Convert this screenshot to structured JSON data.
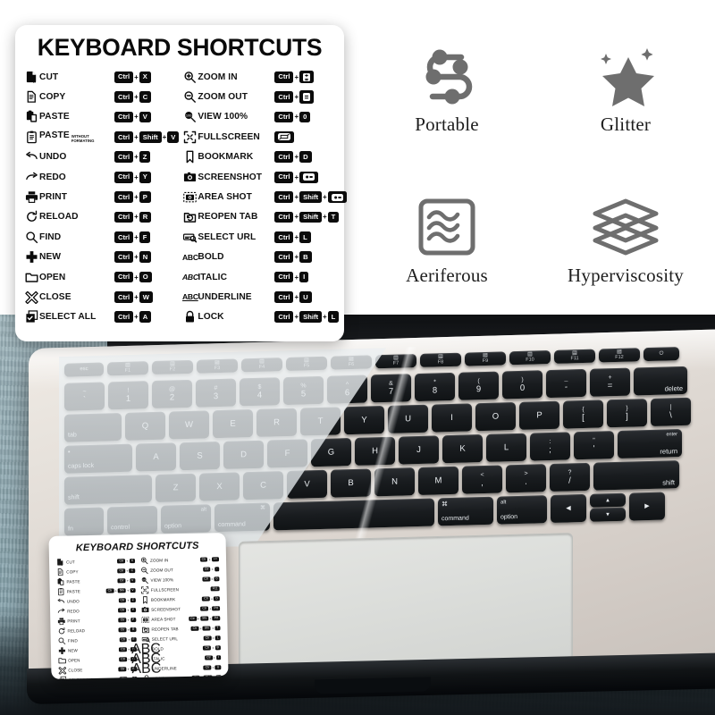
{
  "card": {
    "title": "KEYBOARD SHORTCUTS",
    "left_column": [
      {
        "icon": "cut-icon",
        "label": "CUT",
        "keys": [
          "Ctrl",
          "X"
        ]
      },
      {
        "icon": "copy-icon",
        "label": "COPY",
        "keys": [
          "Ctrl",
          "C"
        ]
      },
      {
        "icon": "paste-icon",
        "label": "PASTE",
        "keys": [
          "Ctrl",
          "V"
        ]
      },
      {
        "icon": "paste-plain-icon",
        "label": "PASTE",
        "sub": "WITHOUT FORMATING",
        "keys": [
          "Ctrl",
          "Shift",
          "V"
        ]
      },
      {
        "icon": "undo-icon",
        "label": "UNDO",
        "keys": [
          "Ctrl",
          "Z"
        ]
      },
      {
        "icon": "redo-icon",
        "label": "REDO",
        "keys": [
          "Ctrl",
          "Y"
        ]
      },
      {
        "icon": "print-icon",
        "label": "PRINT",
        "keys": [
          "Ctrl",
          "P"
        ]
      },
      {
        "icon": "reload-icon",
        "label": "RELOAD",
        "keys": [
          "Ctrl",
          "R"
        ]
      },
      {
        "icon": "find-icon",
        "label": "FIND",
        "keys": [
          "Ctrl",
          "F"
        ]
      },
      {
        "icon": "new-icon",
        "label": "NEW",
        "keys": [
          "Ctrl",
          "N"
        ]
      },
      {
        "icon": "open-folder-icon",
        "label": "OPEN",
        "keys": [
          "Ctrl",
          "O"
        ]
      },
      {
        "icon": "close-icon",
        "label": "CLOSE",
        "keys": [
          "Ctrl",
          "W"
        ]
      },
      {
        "icon": "select-all-icon",
        "label": "SELECT ALL",
        "keys": [
          "Ctrl",
          "A"
        ]
      }
    ],
    "right_column": [
      {
        "icon": "zoom-in-icon",
        "label": "ZOOM IN",
        "keys": [
          "Ctrl",
          "+="
        ]
      },
      {
        "icon": "zoom-out-icon",
        "label": "ZOOM OUT",
        "keys": [
          "Ctrl",
          "-"
        ]
      },
      {
        "icon": "view-100-icon",
        "label": "VIEW 100%",
        "keys": [
          "Ctrl",
          "0"
        ]
      },
      {
        "icon": "fullscreen-icon",
        "label": "FULLSCREEN",
        "keys": [
          "F11"
        ]
      },
      {
        "icon": "bookmark-icon",
        "label": "BOOKMARK",
        "keys": [
          "Ctrl",
          "D"
        ]
      },
      {
        "icon": "screenshot-icon",
        "label": "SCREENSHOT",
        "keys": [
          "Ctrl",
          "PrtSc"
        ]
      },
      {
        "icon": "area-shot-icon",
        "label": "AREA SHOT",
        "keys": [
          "Ctrl",
          "Shift",
          "PrtSc"
        ]
      },
      {
        "icon": "reopen-tab-icon",
        "label": "REOPEN TAB",
        "keys": [
          "Ctrl",
          "Shift",
          "T"
        ]
      },
      {
        "icon": "select-url-icon",
        "label": "SELECT URL",
        "keys": [
          "Ctrl",
          "L"
        ]
      },
      {
        "icon": "bold-abc-icon",
        "label": "BOLD",
        "keys": [
          "Ctrl",
          "B"
        ]
      },
      {
        "icon": "italic-abc-icon",
        "label": "ITALIC",
        "keys": [
          "Ctrl",
          "I"
        ]
      },
      {
        "icon": "underline-abc-icon",
        "label": "UNDERLINE",
        "keys": [
          "Ctrl",
          "U"
        ]
      },
      {
        "icon": "lock-icon",
        "label": "LOCK",
        "keys": [
          "Ctrl",
          "Shift",
          "L"
        ]
      }
    ]
  },
  "features": [
    {
      "icon": "route-path-icon",
      "label": "Portable"
    },
    {
      "icon": "sparkle-star-icon",
      "label": "Glitter"
    },
    {
      "icon": "air-waves-icon",
      "label": "Aeriferous"
    },
    {
      "icon": "layers-icon",
      "label": "Hyperviscosity"
    }
  ],
  "keyboard": {
    "function_row": [
      "esc",
      "F1",
      "F2",
      "F3",
      "F4",
      "F5",
      "F6",
      "F7",
      "F8",
      "F9",
      "F10",
      "F11",
      "F12",
      ""
    ],
    "number_row": [
      {
        "up": "~",
        "lo": "`"
      },
      {
        "up": "!",
        "lo": "1"
      },
      {
        "up": "@",
        "lo": "2"
      },
      {
        "up": "#",
        "lo": "3"
      },
      {
        "up": "$",
        "lo": "4"
      },
      {
        "up": "%",
        "lo": "5"
      },
      {
        "up": "^",
        "lo": "6"
      },
      {
        "up": "&",
        "lo": "7"
      },
      {
        "up": "*",
        "lo": "8"
      },
      {
        "up": "(",
        "lo": "9"
      },
      {
        "up": ")",
        "lo": "0"
      },
      {
        "up": "_",
        "lo": "-"
      },
      {
        "up": "+",
        "lo": "="
      },
      {
        "up": "",
        "lo": "delete"
      }
    ],
    "row_q": [
      "tab",
      "Q",
      "W",
      "E",
      "R",
      "T",
      "Y",
      "U",
      "I",
      "O",
      "P",
      "{ [",
      "} ]",
      "| \\"
    ],
    "row_a": [
      "caps lock",
      "A",
      "S",
      "D",
      "F",
      "G",
      "H",
      "J",
      "K",
      "L",
      ": ;",
      "\" '",
      "return"
    ],
    "row_z": [
      "shift",
      "Z",
      "X",
      "C",
      "V",
      "B",
      "N",
      "M",
      "< ,",
      "> .",
      "? /",
      "shift"
    ],
    "bottom_row": [
      "fn",
      "control",
      "option",
      "command",
      "",
      "command",
      "option"
    ],
    "modifier_marks": {
      "option_mark": "alt",
      "command_mark": "⌘",
      "power": "⏻",
      "enter_small": "enter"
    },
    "arrows": {
      "left": "◀",
      "up": "▲",
      "down": "▼",
      "right": "▶"
    }
  },
  "mini_card": {
    "title": "KEYBOARD SHORTCUTS"
  },
  "colors": {
    "card_bg": "#ffffff",
    "key_black": "#0b0b0b",
    "feature_icon": "#6e6e6e",
    "wood_bg": "#8aa6af",
    "laptop_silver": "#ded8d2"
  }
}
